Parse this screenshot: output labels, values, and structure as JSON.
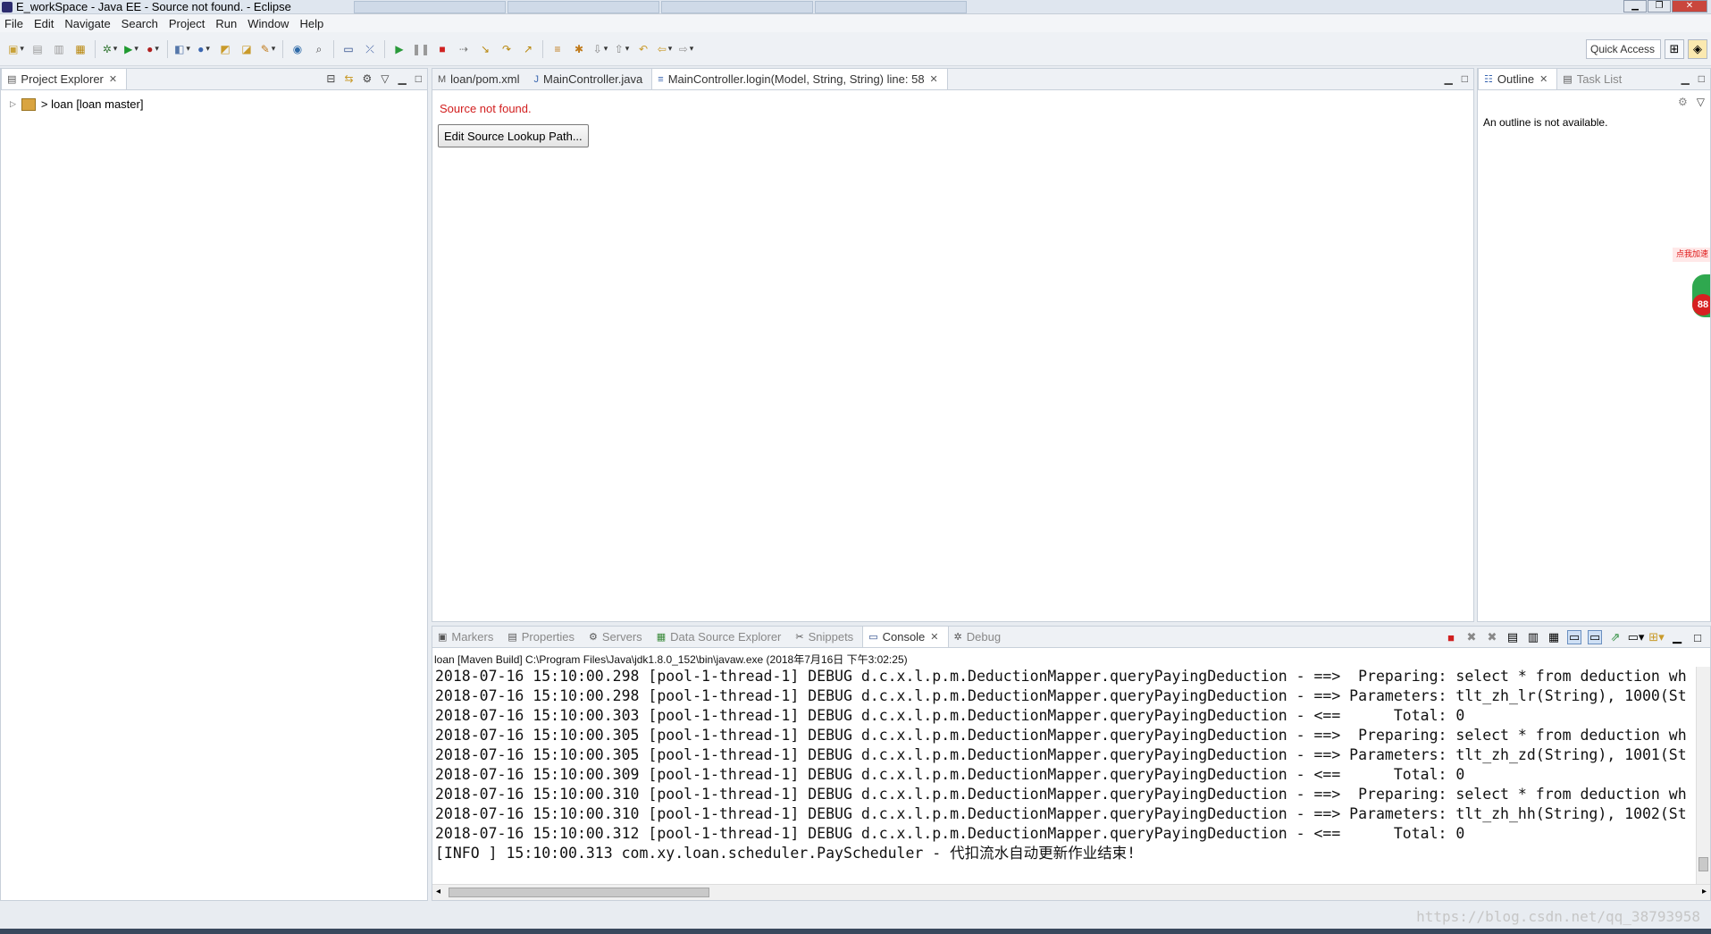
{
  "window": {
    "title": "E_workSpace - Java EE - Source not found. - Eclipse"
  },
  "menu": [
    "File",
    "Edit",
    "Navigate",
    "Search",
    "Project",
    "Run",
    "Window",
    "Help"
  ],
  "toolbar": {
    "quick_access": "Quick Access"
  },
  "project_explorer": {
    "tab_label": "Project Explorer",
    "tree": [
      {
        "label": "> loan [loan master]"
      }
    ]
  },
  "editor": {
    "tabs": [
      {
        "label": "loan/pom.xml"
      },
      {
        "label": "MainController.java"
      },
      {
        "label": "MainController.login(Model, String, String) line: 58"
      }
    ],
    "message": "Source not found.",
    "button": "Edit Source Lookup Path..."
  },
  "outline": {
    "tabs": [
      "Outline",
      "Task List"
    ],
    "message": "An outline is not available.",
    "widget_label": "点我加速",
    "widget_badge": "88"
  },
  "bottom_panel": {
    "tabs": [
      "Markers",
      "Properties",
      "Servers",
      "Data Source Explorer",
      "Snippets",
      "Console",
      "Debug"
    ],
    "console_path": "loan [Maven Build] C:\\Program Files\\Java\\jdk1.8.0_152\\bin\\javaw.exe (2018年7月16日 下午3:02:25)",
    "lines": [
      "2018-07-16 15:10:00.298 [pool-1-thread-1] DEBUG d.c.x.l.p.m.DeductionMapper.queryPayingDeduction - ==>  Preparing: select * from deduction wh",
      "2018-07-16 15:10:00.298 [pool-1-thread-1] DEBUG d.c.x.l.p.m.DeductionMapper.queryPayingDeduction - ==> Parameters: tlt_zh_lr(String), 1000(St",
      "2018-07-16 15:10:00.303 [pool-1-thread-1] DEBUG d.c.x.l.p.m.DeductionMapper.queryPayingDeduction - <==      Total: 0",
      "2018-07-16 15:10:00.305 [pool-1-thread-1] DEBUG d.c.x.l.p.m.DeductionMapper.queryPayingDeduction - ==>  Preparing: select * from deduction wh",
      "2018-07-16 15:10:00.305 [pool-1-thread-1] DEBUG d.c.x.l.p.m.DeductionMapper.queryPayingDeduction - ==> Parameters: tlt_zh_zd(String), 1001(St",
      "2018-07-16 15:10:00.309 [pool-1-thread-1] DEBUG d.c.x.l.p.m.DeductionMapper.queryPayingDeduction - <==      Total: 0",
      "2018-07-16 15:10:00.310 [pool-1-thread-1] DEBUG d.c.x.l.p.m.DeductionMapper.queryPayingDeduction - ==>  Preparing: select * from deduction wh",
      "2018-07-16 15:10:00.310 [pool-1-thread-1] DEBUG d.c.x.l.p.m.DeductionMapper.queryPayingDeduction - ==> Parameters: tlt_zh_hh(String), 1002(St",
      "2018-07-16 15:10:00.312 [pool-1-thread-1] DEBUG d.c.x.l.p.m.DeductionMapper.queryPayingDeduction - <==      Total: 0",
      "[INFO ] 15:10:00.313 com.xy.loan.scheduler.PayScheduler - 代扣流水自动更新作业结束!"
    ]
  },
  "watermark": "https://blog.csdn.net/qq_38793958",
  "colors": {
    "error_text": "#d21e1e",
    "chrome_bg": "#eef1f5"
  }
}
